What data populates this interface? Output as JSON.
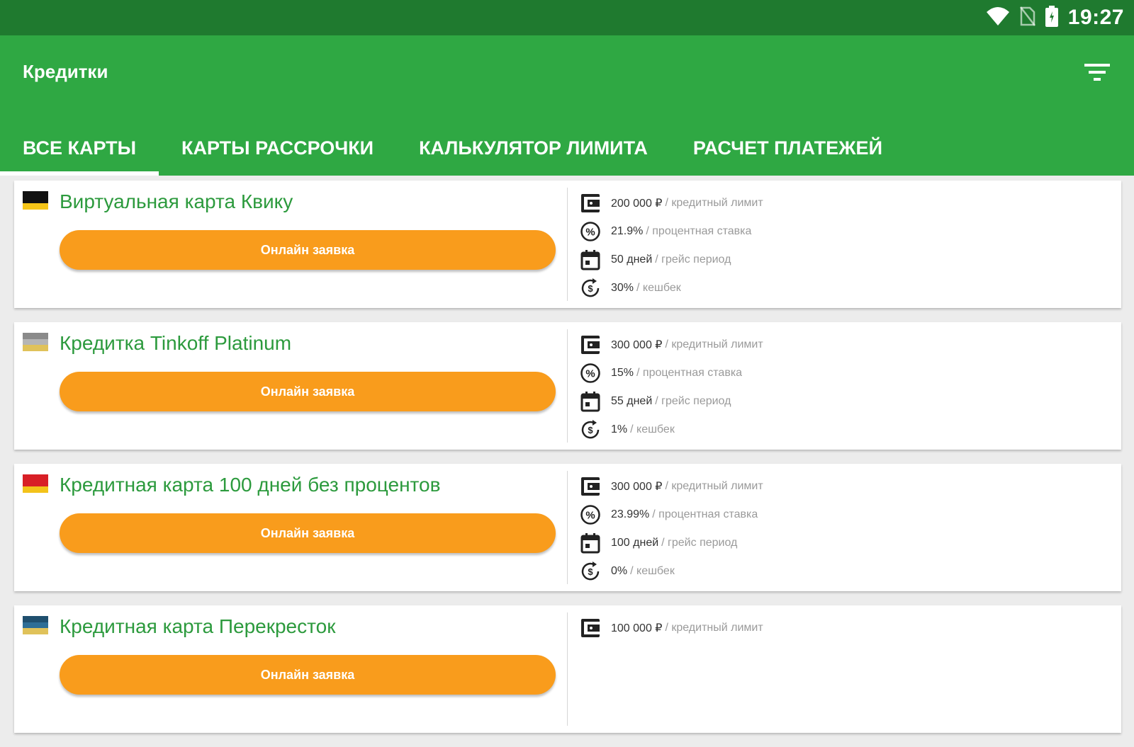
{
  "status_bar": {
    "time": "19:27",
    "icons": [
      "wifi-icon",
      "no-sim-icon",
      "battery-icon"
    ]
  },
  "app_bar": {
    "title": "Кредитки",
    "filter_icon": "filter-icon"
  },
  "tabs": [
    {
      "label": "ВСЕ КАРТЫ",
      "active": true
    },
    {
      "label": "КАРТЫ РАССРОЧКИ",
      "active": false
    },
    {
      "label": "КАЛЬКУЛЯТОР ЛИМИТА",
      "active": false
    },
    {
      "label": "РАСЧЕТ ПЛАТЕЖЕЙ",
      "active": false
    }
  ],
  "colors": {
    "status_bar": "#1f7a2f",
    "app_bar": "#2fa843",
    "title_green": "#2c9a3d",
    "button_orange": "#f99c1c"
  },
  "cards": [
    {
      "title": "Виртуальная карта Квику",
      "flag_colors": [
        "#111111",
        "#111111",
        "#f5c518"
      ],
      "button": "Онлайн заявка",
      "facts": [
        {
          "icon": "wallet-icon",
          "value": "200 000 ₽",
          "label": "/ кредитный лимит"
        },
        {
          "icon": "percent-icon",
          "value": "21.9%",
          "label": "/ процентная ставка"
        },
        {
          "icon": "calendar-icon",
          "value": "50 дней",
          "label": "/ грейс период"
        },
        {
          "icon": "cashback-icon",
          "value": "30%",
          "label": "/ кешбек"
        }
      ]
    },
    {
      "title": "Кредитка Tinkoff Platinum",
      "flag_colors": [
        "#8a8a8a",
        "#b5b5b5",
        "#e0c25a"
      ],
      "button": "Онлайн заявка",
      "facts": [
        {
          "icon": "wallet-icon",
          "value": "300 000 ₽",
          "label": "/ кредитный лимит"
        },
        {
          "icon": "percent-icon",
          "value": "15%",
          "label": "/ процентная ставка"
        },
        {
          "icon": "calendar-icon",
          "value": "55 дней",
          "label": "/ грейс период"
        },
        {
          "icon": "cashback-icon",
          "value": "1%",
          "label": "/ кешбек"
        }
      ]
    },
    {
      "title": "Кредитная карта 100 дней без процентов",
      "flag_colors": [
        "#d81f26",
        "#d81f26",
        "#f3c31a"
      ],
      "button": "Онлайн заявка",
      "facts": [
        {
          "icon": "wallet-icon",
          "value": "300 000 ₽",
          "label": "/ кредитный лимит"
        },
        {
          "icon": "percent-icon",
          "value": "23.99%",
          "label": "/ процентная ставка"
        },
        {
          "icon": "calendar-icon",
          "value": "100 дней",
          "label": "/ грейс период"
        },
        {
          "icon": "cashback-icon",
          "value": "0%",
          "label": "/ кешбек"
        }
      ]
    },
    {
      "title": "Кредитная карта Перекресток",
      "flag_colors": [
        "#1f4f6e",
        "#2e6e96",
        "#e0c25a"
      ],
      "button": "Онлайн заявка",
      "facts": [
        {
          "icon": "wallet-icon",
          "value": "100 000 ₽",
          "label": "/ кредитный лимит"
        },
        {
          "icon": "percent-icon",
          "value": "",
          "label": ""
        },
        {
          "icon": "calendar-icon",
          "value": "",
          "label": ""
        },
        {
          "icon": "cashback-icon",
          "value": "",
          "label": ""
        }
      ]
    }
  ]
}
